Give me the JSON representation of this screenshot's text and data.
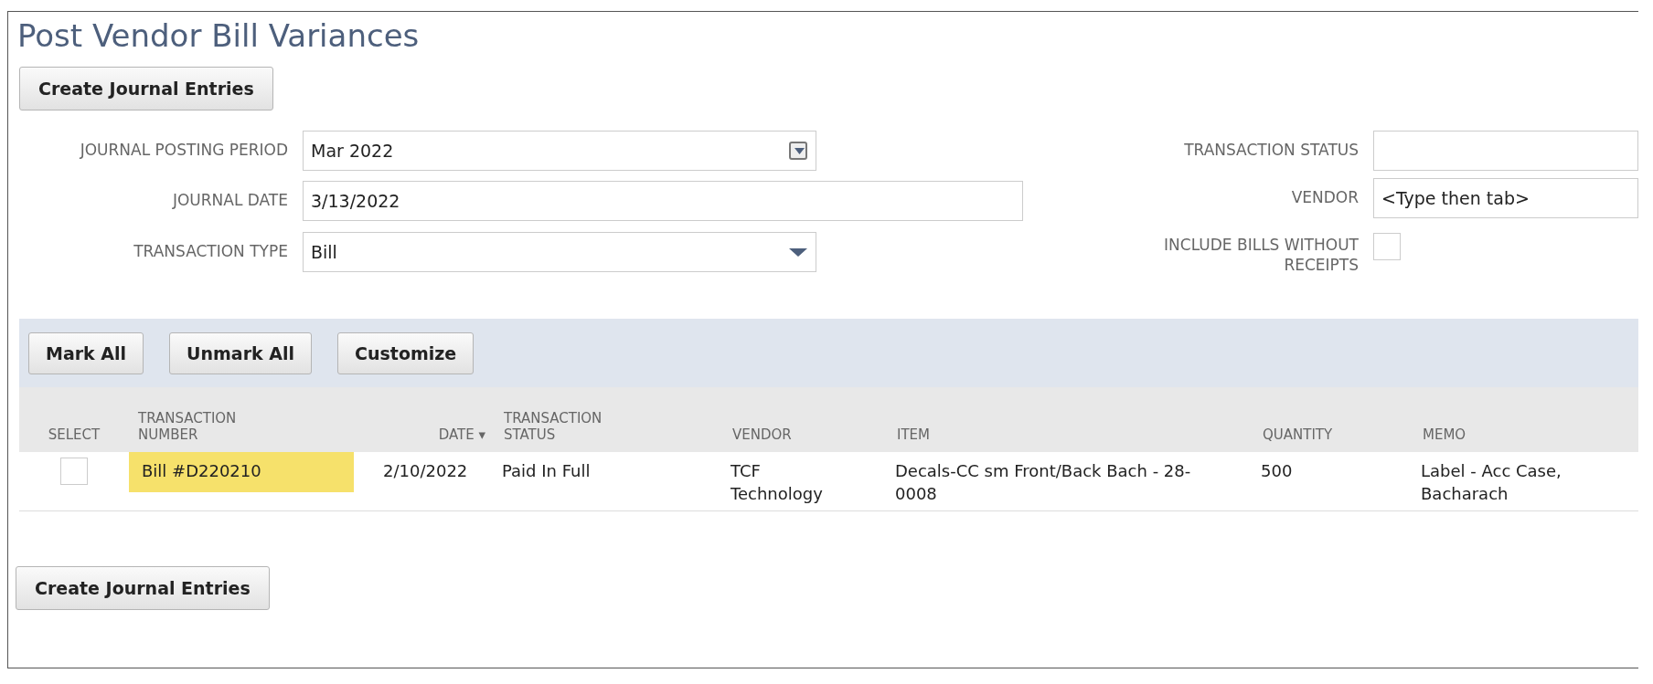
{
  "title": "Post Vendor Bill Variances",
  "top_button": "Create Journal Entries",
  "form_left": [
    {
      "kind": "select",
      "label": "JOURNAL POSTING PERIOD",
      "value": "Mar 2022"
    },
    {
      "kind": "text",
      "label": "JOURNAL DATE",
      "value": "3/13/2022"
    },
    {
      "kind": "dropdown",
      "label": "TRANSACTION TYPE",
      "value": "Bill"
    }
  ],
  "form_right": [
    {
      "kind": "text",
      "label": "TRANSACTION STATUS"
    },
    {
      "kind": "text",
      "label": "VENDOR",
      "value": "<Type then tab>"
    },
    {
      "kind": "checkbox",
      "label": "INCLUDE BILLS WITHOUT RECEIPTS",
      "checked": false
    }
  ],
  "toolbar": [
    "Mark All",
    "Unmark All",
    "Customize"
  ],
  "table": {
    "columns": [
      "SELECT",
      "TRANSACTION NUMBER",
      "DATE ▾",
      "TRANSACTION STATUS",
      "VENDOR",
      "ITEM",
      "QUANTITY",
      "MEMO"
    ],
    "rows": [
      {
        "selected": false,
        "number": "Bill #D220210",
        "highlighted": true,
        "date": "2/10/2022",
        "status": "Paid In Full",
        "vendor": "TCF Technology",
        "item": "Decals-CC sm Front/Back Bach - 28-0008",
        "quantity": "500",
        "memo": "Label - Acc Case, Bacharach"
      }
    ]
  },
  "bottom_button": "Create Journal Entries"
}
